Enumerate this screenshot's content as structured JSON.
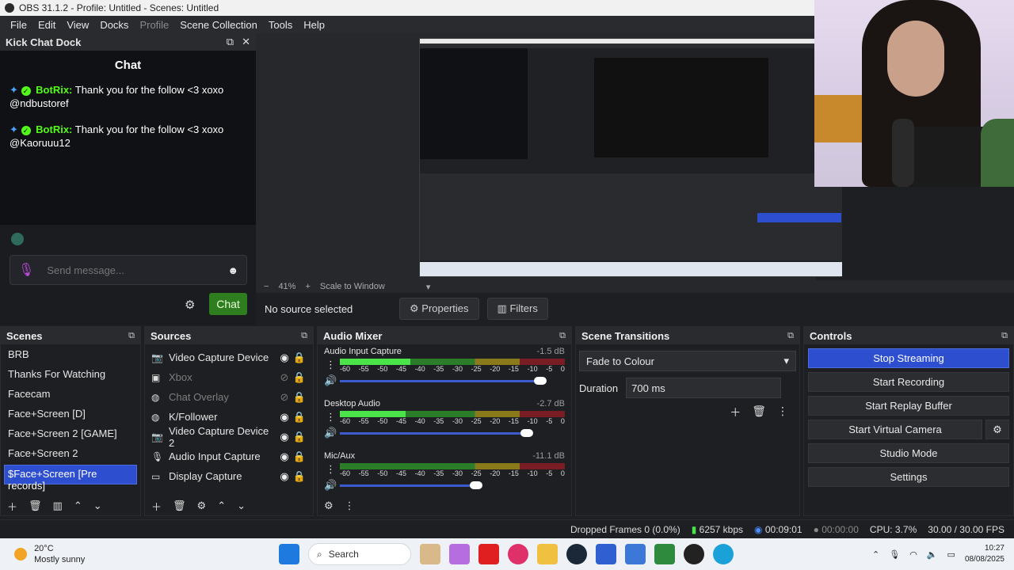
{
  "window": {
    "title": "OBS 31.1.2 - Profile: Untitled - Scenes: Untitled"
  },
  "menu": [
    "File",
    "Edit",
    "View",
    "Docks",
    "Profile",
    "Scene Collection",
    "Tools",
    "Help"
  ],
  "chat_dock": {
    "title": "Kick Chat Dock",
    "pane_title": "Chat",
    "messages": [
      {
        "user": "BotRix:",
        "text": "Thank you for the follow <3 xoxo",
        "mention": "@ndbustoref"
      },
      {
        "user": "BotRix:",
        "text": "Thank you for the follow <3 xoxo",
        "mention": "@Kaoruuu12"
      }
    ],
    "input_placeholder": "Send message...",
    "chat_button": "Chat"
  },
  "preview": {
    "zoom": "41%",
    "scale_mode": "Scale to Window",
    "context_label": "No source selected",
    "properties_label": "Properties",
    "filters_label": "Filters"
  },
  "scenes": {
    "title": "Scenes",
    "items": [
      "BRB",
      "Thanks For Watching",
      "Facecam",
      "Face+Screen [D]",
      "Face+Screen 2 [GAME]",
      "Face+Screen 2",
      "$Face+Screen [Pre records]"
    ],
    "selected": 6
  },
  "sources": {
    "title": "Sources",
    "items": [
      {
        "label": "Video Capture Device",
        "icon": "camera-icon",
        "visible": true
      },
      {
        "label": "Xbox",
        "icon": "image-icon",
        "visible": false
      },
      {
        "label": "Chat Overlay",
        "icon": "globe-icon",
        "visible": false
      },
      {
        "label": "K/Follower",
        "icon": "globe-icon",
        "visible": true
      },
      {
        "label": "Video Capture Device 2",
        "icon": "camera-icon",
        "visible": true
      },
      {
        "label": "Audio Input Capture",
        "icon": "mic-icon",
        "visible": true
      },
      {
        "label": "Display Capture",
        "icon": "monitor-icon",
        "visible": true
      }
    ]
  },
  "audio_mixer": {
    "title": "Audio Mixer",
    "ticks": [
      "-60",
      "-55",
      "-50",
      "-45",
      "-40",
      "-35",
      "-30",
      "-25",
      "-20",
      "-15",
      "-10",
      "-5",
      "0"
    ],
    "channels": [
      {
        "name": "Audio Input Capture",
        "db": "-1.5 dB",
        "level": 0.32,
        "fader": 0.91
      },
      {
        "name": "Desktop Audio",
        "db": "-2.7 dB",
        "level": 0.3,
        "fader": 0.85
      },
      {
        "name": "Mic/Aux",
        "db": "-11.1 dB",
        "level": 0.0,
        "fader": 0.62
      }
    ]
  },
  "scene_transitions": {
    "title": "Scene Transitions",
    "transition": "Fade to Colour",
    "duration_label": "Duration",
    "duration_value": "700 ms"
  },
  "controls": {
    "title": "Controls",
    "buttons": [
      "Stop Streaming",
      "Start Recording",
      "Start Replay Buffer",
      "Start Virtual Camera",
      "Studio Mode",
      "Settings"
    ]
  },
  "status_bar": {
    "dropped_frames": "Dropped Frames 0 (0.0%)",
    "bitrate": "6257 kbps",
    "stream_time": "00:09:01",
    "record_time": "00:00:00",
    "cpu": "CPU: 3.7%",
    "fps": "30.00 / 30.00 FPS"
  },
  "taskbar": {
    "temperature": "20°C",
    "weather": "Mostly sunny",
    "search": "Search",
    "time": "10:27",
    "date": "08/08/2025"
  },
  "colors": {
    "accent": "#2d4fcf",
    "kick_green": "#53fc18"
  }
}
